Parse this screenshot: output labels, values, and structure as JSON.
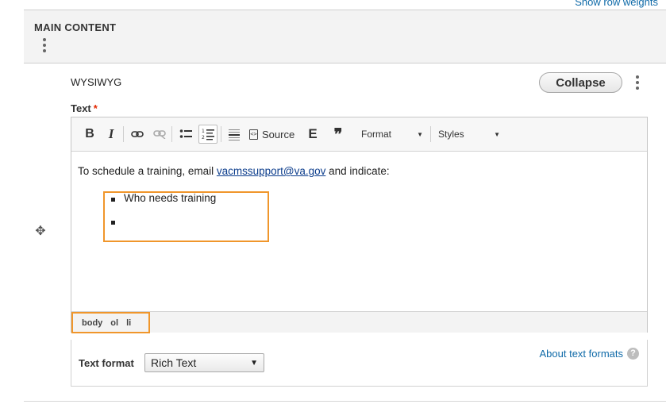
{
  "top_link": "Show row weights",
  "main_content": {
    "title": "MAIN CONTENT"
  },
  "paragraph": {
    "type_label": "WYSIWYG",
    "collapse_label": "Collapse"
  },
  "field": {
    "label": "Text",
    "required_mark": "*"
  },
  "toolbar": {
    "bold": "B",
    "italic": "I",
    "source_label": "Source",
    "embed": "E",
    "quote": "❞",
    "format_label": "Format",
    "styles_label": "Styles"
  },
  "content": {
    "intro_before": "To schedule a training, email ",
    "email": "vacmssupport@va.gov",
    "intro_after": " and indicate:",
    "list_items": [
      "Who needs training",
      ""
    ]
  },
  "path_bar": {
    "items": [
      "body",
      "ol",
      "li"
    ]
  },
  "text_format": {
    "label": "Text format",
    "selected": "Rich Text",
    "about_link": "About text formats",
    "help_glyph": "?"
  },
  "highlight_color": "#f0962b",
  "link_color": "#0f6aa8"
}
